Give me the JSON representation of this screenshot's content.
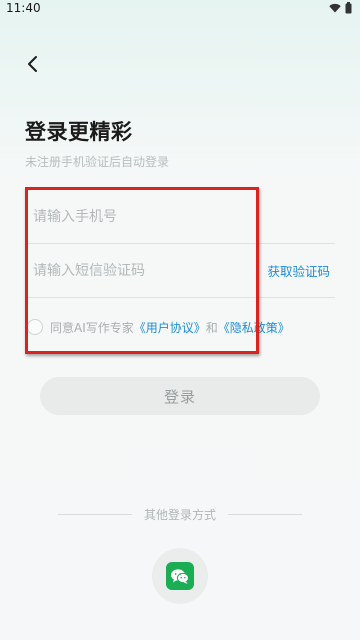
{
  "status_bar": {
    "time": "11:40",
    "icons": [
      "wifi-icon",
      "battery-icon"
    ]
  },
  "header": {
    "back_icon": "chevron-left-icon"
  },
  "title": "登录更精彩",
  "subtitle": "未注册手机验证后自动登录",
  "phone": {
    "placeholder": "请输入手机号",
    "value": ""
  },
  "code": {
    "placeholder": "请输入短信验证码",
    "value": "",
    "get_code_label": "获取验证码"
  },
  "agreement": {
    "checked": false,
    "prefix": "同意AI写作专家",
    "user_agreement": "《用户协议》",
    "connector": "和",
    "privacy_policy": "《隐私政策》"
  },
  "login_button": "登录",
  "other_login": {
    "label": "其他登录方式",
    "methods": [
      "wechat-icon"
    ]
  },
  "colors": {
    "accent_link": "#1e8cd8",
    "wechat_green": "#1aad54",
    "highlight_red": "#d9231f"
  }
}
